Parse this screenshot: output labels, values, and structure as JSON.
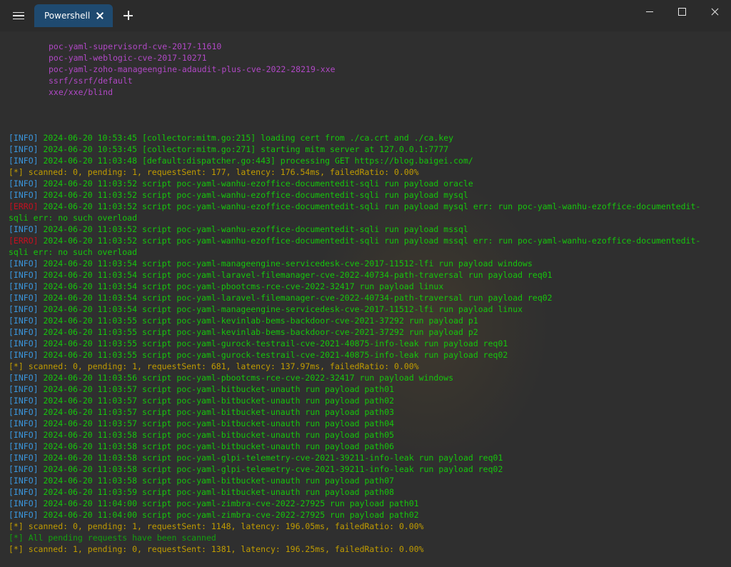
{
  "tab": {
    "title": "Powershell"
  },
  "icons": {
    "menu": "hamburger-icon",
    "tab_close": "close-icon",
    "new_tab": "plus-icon",
    "minimize": "minimize-icon",
    "maximize": "maximize-icon",
    "close": "close-icon"
  },
  "colors": {
    "background": "#2f2f2f",
    "tab_active": "#1f4a70",
    "info": "#16c60c",
    "poc_list": "#b148c6",
    "status": "#c19c00",
    "error": "#c50f1f",
    "done": "#13a10e",
    "prefix": "#3a96dd"
  },
  "poc_list": [
    "poc-yaml-supervisord-cve-2017-11610",
    "poc-yaml-weblogic-cve-2017-10271",
    "poc-yaml-zoho-manageengine-adaudit-plus-cve-2022-28219-xxe",
    "ssrf/ssrf/default",
    "xxe/xxe/blind"
  ],
  "log": [
    {
      "type": "info",
      "prefix": "[INFO]",
      "text": " 2024-06-20 10:53:45 [collector:mitm.go:215] loading cert from ./ca.crt and ./ca.key"
    },
    {
      "type": "info",
      "prefix": "[INFO]",
      "text": " 2024-06-20 10:53:45 [collector:mitm.go:271] starting mitm server at 127.0.0.1:7777"
    },
    {
      "type": "info",
      "prefix": "[INFO]",
      "text": " 2024-06-20 11:03:48 [default:dispatcher.go:443] processing GET https://blog.baigei.com/"
    },
    {
      "type": "status",
      "prefix": "",
      "text": "[*] scanned: 0, pending: 1, requestSent: 177, latency: 176.54ms, failedRatio: 0.00%"
    },
    {
      "type": "info",
      "prefix": "[INFO]",
      "text": " 2024-06-20 11:03:52 script poc-yaml-wanhu-ezoffice-documentedit-sqli run payload oracle"
    },
    {
      "type": "info",
      "prefix": "[INFO]",
      "text": " 2024-06-20 11:03:52 script poc-yaml-wanhu-ezoffice-documentedit-sqli run payload mysql"
    },
    {
      "type": "error",
      "prefix": "[ERRO]",
      "text": " 2024-06-20 11:03:52 script poc-yaml-wanhu-ezoffice-documentedit-sqli run payload mysql err: run poc-yaml-wanhu-ezoffice-documentedit-"
    },
    {
      "type": "error-cont",
      "prefix": "",
      "text": "sqli err: no such overload"
    },
    {
      "type": "info",
      "prefix": "[INFO]",
      "text": " 2024-06-20 11:03:52 script poc-yaml-wanhu-ezoffice-documentedit-sqli run payload mssql"
    },
    {
      "type": "error",
      "prefix": "[ERRO]",
      "text": " 2024-06-20 11:03:52 script poc-yaml-wanhu-ezoffice-documentedit-sqli run payload mssql err: run poc-yaml-wanhu-ezoffice-documentedit-"
    },
    {
      "type": "error-cont",
      "prefix": "",
      "text": "sqli err: no such overload"
    },
    {
      "type": "info",
      "prefix": "[INFO]",
      "text": " 2024-06-20 11:03:54 script poc-yaml-manageengine-servicedesk-cve-2017-11512-lfi run payload windows"
    },
    {
      "type": "info",
      "prefix": "[INFO]",
      "text": " 2024-06-20 11:03:54 script poc-yaml-laravel-filemanager-cve-2022-40734-path-traversal run payload req01"
    },
    {
      "type": "info",
      "prefix": "[INFO]",
      "text": " 2024-06-20 11:03:54 script poc-yaml-pbootcms-rce-cve-2022-32417 run payload linux"
    },
    {
      "type": "info",
      "prefix": "[INFO]",
      "text": " 2024-06-20 11:03:54 script poc-yaml-laravel-filemanager-cve-2022-40734-path-traversal run payload req02"
    },
    {
      "type": "info",
      "prefix": "[INFO]",
      "text": " 2024-06-20 11:03:54 script poc-yaml-manageengine-servicedesk-cve-2017-11512-lfi run payload linux"
    },
    {
      "type": "info",
      "prefix": "[INFO]",
      "text": " 2024-06-20 11:03:55 script poc-yaml-kevinlab-bems-backdoor-cve-2021-37292 run payload p1"
    },
    {
      "type": "info",
      "prefix": "[INFO]",
      "text": " 2024-06-20 11:03:55 script poc-yaml-kevinlab-bems-backdoor-cve-2021-37292 run payload p2"
    },
    {
      "type": "info",
      "prefix": "[INFO]",
      "text": " 2024-06-20 11:03:55 script poc-yaml-gurock-testrail-cve-2021-40875-info-leak run payload req01"
    },
    {
      "type": "info",
      "prefix": "[INFO]",
      "text": " 2024-06-20 11:03:55 script poc-yaml-gurock-testrail-cve-2021-40875-info-leak run payload req02"
    },
    {
      "type": "status",
      "prefix": "",
      "text": "[*] scanned: 0, pending: 1, requestSent: 681, latency: 137.97ms, failedRatio: 0.00%"
    },
    {
      "type": "info",
      "prefix": "[INFO]",
      "text": " 2024-06-20 11:03:56 script poc-yaml-pbootcms-rce-cve-2022-32417 run payload windows"
    },
    {
      "type": "info",
      "prefix": "[INFO]",
      "text": " 2024-06-20 11:03:57 script poc-yaml-bitbucket-unauth run payload path01"
    },
    {
      "type": "info",
      "prefix": "[INFO]",
      "text": " 2024-06-20 11:03:57 script poc-yaml-bitbucket-unauth run payload path02"
    },
    {
      "type": "info",
      "prefix": "[INFO]",
      "text": " 2024-06-20 11:03:57 script poc-yaml-bitbucket-unauth run payload path03"
    },
    {
      "type": "info",
      "prefix": "[INFO]",
      "text": " 2024-06-20 11:03:57 script poc-yaml-bitbucket-unauth run payload path04"
    },
    {
      "type": "info",
      "prefix": "[INFO]",
      "text": " 2024-06-20 11:03:58 script poc-yaml-bitbucket-unauth run payload path05"
    },
    {
      "type": "info",
      "prefix": "[INFO]",
      "text": " 2024-06-20 11:03:58 script poc-yaml-bitbucket-unauth run payload path06"
    },
    {
      "type": "info",
      "prefix": "[INFO]",
      "text": " 2024-06-20 11:03:58 script poc-yaml-glpi-telemetry-cve-2021-39211-info-leak run payload req01"
    },
    {
      "type": "info",
      "prefix": "[INFO]",
      "text": " 2024-06-20 11:03:58 script poc-yaml-glpi-telemetry-cve-2021-39211-info-leak run payload req02"
    },
    {
      "type": "info",
      "prefix": "[INFO]",
      "text": " 2024-06-20 11:03:58 script poc-yaml-bitbucket-unauth run payload path07"
    },
    {
      "type": "info",
      "prefix": "[INFO]",
      "text": " 2024-06-20 11:03:59 script poc-yaml-bitbucket-unauth run payload path08"
    },
    {
      "type": "info",
      "prefix": "[INFO]",
      "text": " 2024-06-20 11:04:00 script poc-yaml-zimbra-cve-2022-27925 run payload path01"
    },
    {
      "type": "info",
      "prefix": "[INFO]",
      "text": " 2024-06-20 11:04:00 script poc-yaml-zimbra-cve-2022-27925 run payload path02"
    },
    {
      "type": "status",
      "prefix": "",
      "text": "[*] scanned: 0, pending: 1, requestSent: 1148, latency: 196.05ms, failedRatio: 0.00%"
    },
    {
      "type": "done",
      "prefix": "",
      "text": "[*] All pending requests have been scanned"
    },
    {
      "type": "status",
      "prefix": "",
      "text": "[*] scanned: 1, pending: 0, requestSent: 1381, latency: 196.25ms, failedRatio: 0.00%"
    }
  ]
}
